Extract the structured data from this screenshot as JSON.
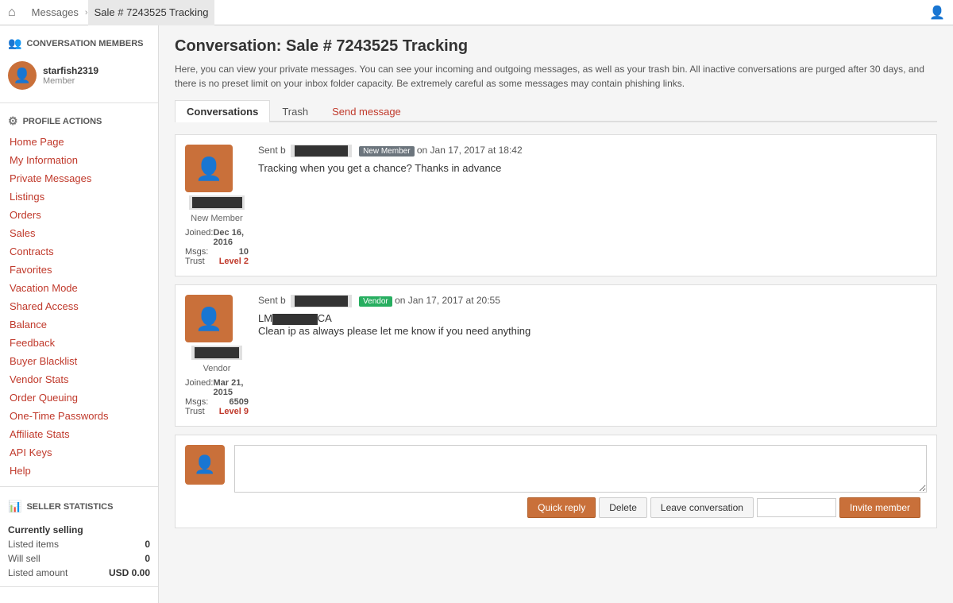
{
  "topnav": {
    "home_icon": "⌂",
    "breadcrumbs": [
      {
        "label": "Messages",
        "active": false
      },
      {
        "label": "Sale # 7243525 Tracking",
        "active": true
      }
    ],
    "user_icon": "👤"
  },
  "sidebar": {
    "conversation_members": {
      "header": "CONVERSATION MEMBERS",
      "header_icon": "👥",
      "user": {
        "name": "starfish2319",
        "role": "Member"
      }
    },
    "profile_actions": {
      "header": "PROFILE ACTIONS",
      "header_icon": "⚙",
      "links": [
        "Home Page",
        "My Information",
        "Private Messages",
        "Listings",
        "Orders",
        "Sales",
        "Contracts",
        "Favorites",
        "Vacation Mode",
        "Shared Access",
        "Balance",
        "Feedback",
        "Buyer Blacklist",
        "Vendor Stats",
        "Order Queuing",
        "One-Time Passwords",
        "Affiliate Stats",
        "API Keys",
        "Help"
      ]
    },
    "seller_statistics": {
      "header": "SELLER STATISTICS",
      "header_icon": "📊",
      "title": "Currently selling",
      "rows": [
        {
          "label": "Listed items",
          "value": "0"
        },
        {
          "label": "Will sell",
          "value": "0"
        },
        {
          "label": "Listed amount",
          "value": "USD 0.00"
        }
      ]
    }
  },
  "content": {
    "title": "Conversation: Sale # 7243525 Tracking",
    "description": "Here, you can view your private messages. You can see your incoming and outgoing messages, as well as your trash bin. All inactive conversations are purged after 30 days, and there is no preset limit on your inbox folder capacity. Be extremely careful as some messages may contain phishing links.",
    "tabs": [
      {
        "label": "Conversations",
        "active": true
      },
      {
        "label": "Trash",
        "active": false
      },
      {
        "label": "Send message",
        "active": false,
        "highlight": true
      }
    ],
    "messages": [
      {
        "id": "msg1",
        "avatar_icon": "👤",
        "username_redacted": true,
        "badge": "New Member",
        "badge_type": "new_member",
        "role": "New Member",
        "joined": "Dec 16, 2016",
        "msgs": "10",
        "trust": "Level 2",
        "trust_level": 2,
        "sent_prefix": "Sent b",
        "sent_suffix": "on Jan 17, 2017 at 18:42",
        "body": "Tracking when you get a chance? Thanks in advance"
      },
      {
        "id": "msg2",
        "avatar_icon": "👤",
        "username_redacted": true,
        "badge": "Vendor",
        "badge_type": "vendor",
        "role": "Vendor",
        "joined": "Mar 21, 2015",
        "msgs": "6509",
        "trust": "Level 9",
        "trust_level": 9,
        "sent_prefix": "Sent b",
        "sent_suffix": "on Jan 17, 2017 at 20:55",
        "tracking_prefix": "LM",
        "tracking_suffix": "CA",
        "body": "Clean ip as always please let me know if you need anything"
      }
    ],
    "reply": {
      "placeholder": "",
      "buttons": {
        "quick_reply": "Quick reply",
        "delete": "Delete",
        "leave_conversation": "Leave conversation",
        "invite_member": "Invite member",
        "invite_placeholder": ""
      }
    }
  }
}
